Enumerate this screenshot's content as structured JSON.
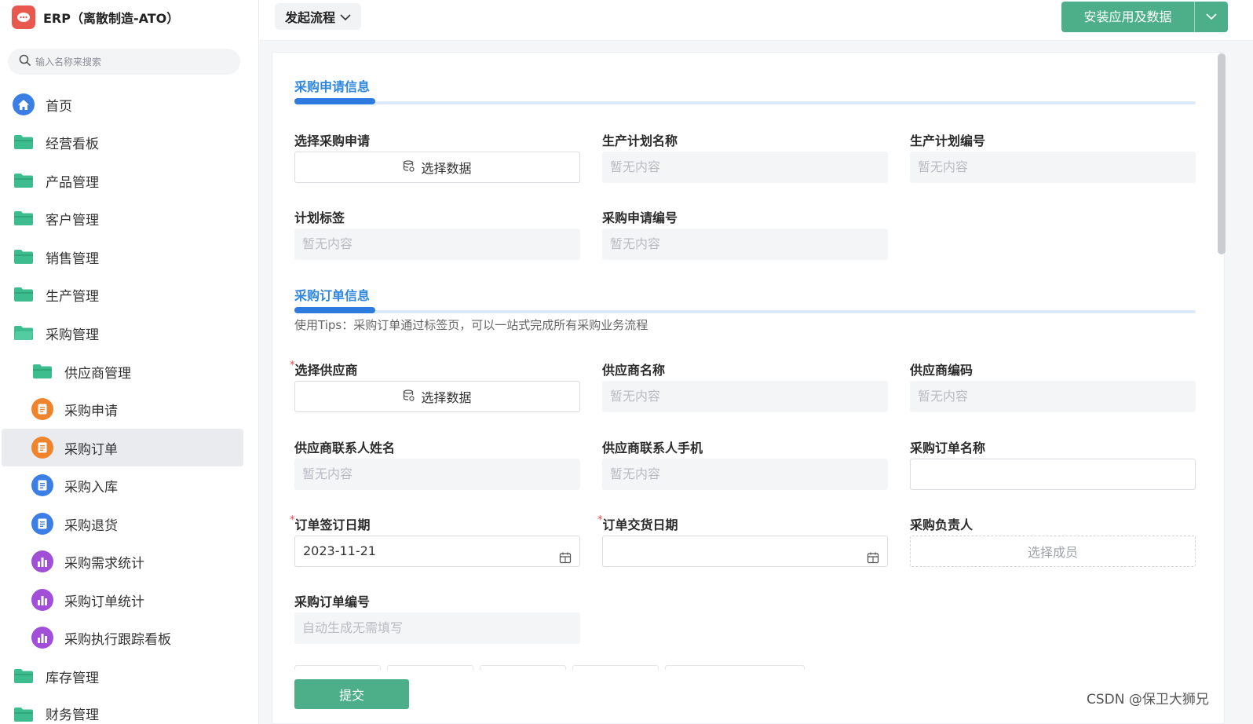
{
  "app": {
    "title": "ERP（离散制造-ATO）"
  },
  "search": {
    "placeholder": "输入名称来搜索"
  },
  "sidebar": {
    "items": [
      {
        "label": "首页",
        "icon": "home-icon"
      },
      {
        "label": "经营看板",
        "icon": "folder-icon"
      },
      {
        "label": "产品管理",
        "icon": "folder-icon"
      },
      {
        "label": "客户管理",
        "icon": "folder-icon"
      },
      {
        "label": "销售管理",
        "icon": "folder-icon"
      },
      {
        "label": "生产管理",
        "icon": "folder-icon"
      },
      {
        "label": "采购管理",
        "icon": "folder-open-icon"
      },
      {
        "label": "供应商管理",
        "icon": "folder-icon"
      },
      {
        "label": "采购申请",
        "icon": "form-icon"
      },
      {
        "label": "采购订单",
        "icon": "form-icon"
      },
      {
        "label": "采购入库",
        "icon": "form-icon"
      },
      {
        "label": "采购退货",
        "icon": "form-icon"
      },
      {
        "label": "采购需求统计",
        "icon": "chart-icon"
      },
      {
        "label": "采购订单统计",
        "icon": "chart-icon"
      },
      {
        "label": "采购执行跟踪看板",
        "icon": "chart-icon"
      },
      {
        "label": "库存管理",
        "icon": "folder-icon"
      },
      {
        "label": "财务管理",
        "icon": "folder-icon"
      }
    ]
  },
  "topbar": {
    "flow_label": "发起流程",
    "install_label": "安装应用及数据"
  },
  "colors": {
    "accent": "#2e86de",
    "primary_green": "#4caf89",
    "folder": "#3dbd8e",
    "orange": "#f0842c",
    "blue": "#3a7ee6",
    "purple": "#a24fd8"
  },
  "form": {
    "section1": {
      "title": "采购申请信息",
      "select_request_label": "选择采购申请",
      "select_data_label": "选择数据",
      "plan_name_label": "生产计划名称",
      "plan_name_value": "暂无内容",
      "plan_no_label": "生产计划编号",
      "plan_no_value": "暂无内容",
      "plan_tag_label": "计划标签",
      "plan_tag_value": "暂无内容",
      "request_no_label": "采购申请编号",
      "request_no_value": "暂无内容"
    },
    "section2": {
      "title": "采购订单信息",
      "tips": "使用Tips：采购订单通过标签页，可以一站式完成所有采购业务流程",
      "supplier_label": "选择供应商",
      "select_data_label": "选择数据",
      "supplier_name_label": "供应商名称",
      "supplier_name_value": "暂无内容",
      "supplier_code_label": "供应商编码",
      "supplier_code_value": "暂无内容",
      "contact_name_label": "供应商联系人姓名",
      "contact_name_value": "暂无内容",
      "contact_phone_label": "供应商联系人手机",
      "contact_phone_value": "暂无内容",
      "order_name_label": "采购订单名称",
      "order_name_value": "",
      "sign_date_label": "订单签订日期",
      "sign_date_value": "2023-11-21",
      "delivery_date_label": "订单交货日期",
      "delivery_date_value": "",
      "owner_label": "采购负责人",
      "owner_placeholder": "选择成员",
      "order_no_label": "采购订单编号",
      "order_no_value": "自动生成无需填写",
      "required_mark": "*"
    },
    "submit_label": "提交"
  },
  "watermark": "CSDN @保卫大狮兄"
}
